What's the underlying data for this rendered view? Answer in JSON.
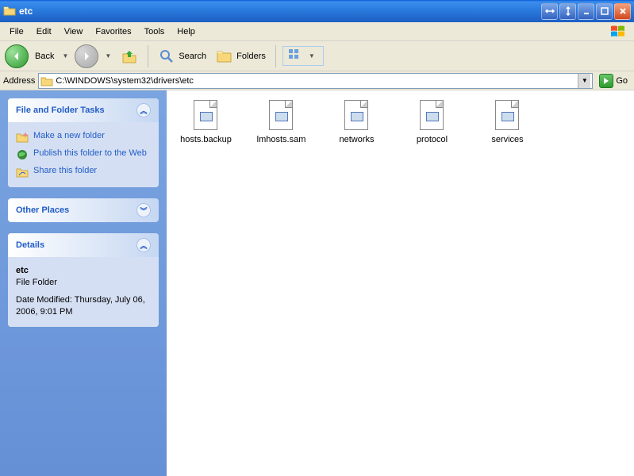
{
  "window": {
    "title": "etc"
  },
  "menu": {
    "items": [
      "File",
      "Edit",
      "View",
      "Favorites",
      "Tools",
      "Help"
    ]
  },
  "toolbar": {
    "back": "Back",
    "search": "Search",
    "folders": "Folders"
  },
  "address": {
    "label": "Address",
    "path": "C:\\WINDOWS\\system32\\drivers\\etc",
    "go": "Go"
  },
  "tasks": {
    "title": "File and Folder Tasks",
    "items": [
      {
        "icon": "new-folder",
        "label": "Make a new folder"
      },
      {
        "icon": "publish",
        "label": "Publish this folder to the Web"
      },
      {
        "icon": "share",
        "label": "Share this folder"
      }
    ]
  },
  "places": {
    "title": "Other Places"
  },
  "details": {
    "title": "Details",
    "name": "etc",
    "type": "File Folder",
    "modified": "Date Modified: Thursday, July 06, 2006, 9:01 PM"
  },
  "files": [
    {
      "name": "hosts.backup"
    },
    {
      "name": "lmhosts.sam"
    },
    {
      "name": "networks"
    },
    {
      "name": "protocol"
    },
    {
      "name": "services"
    }
  ]
}
